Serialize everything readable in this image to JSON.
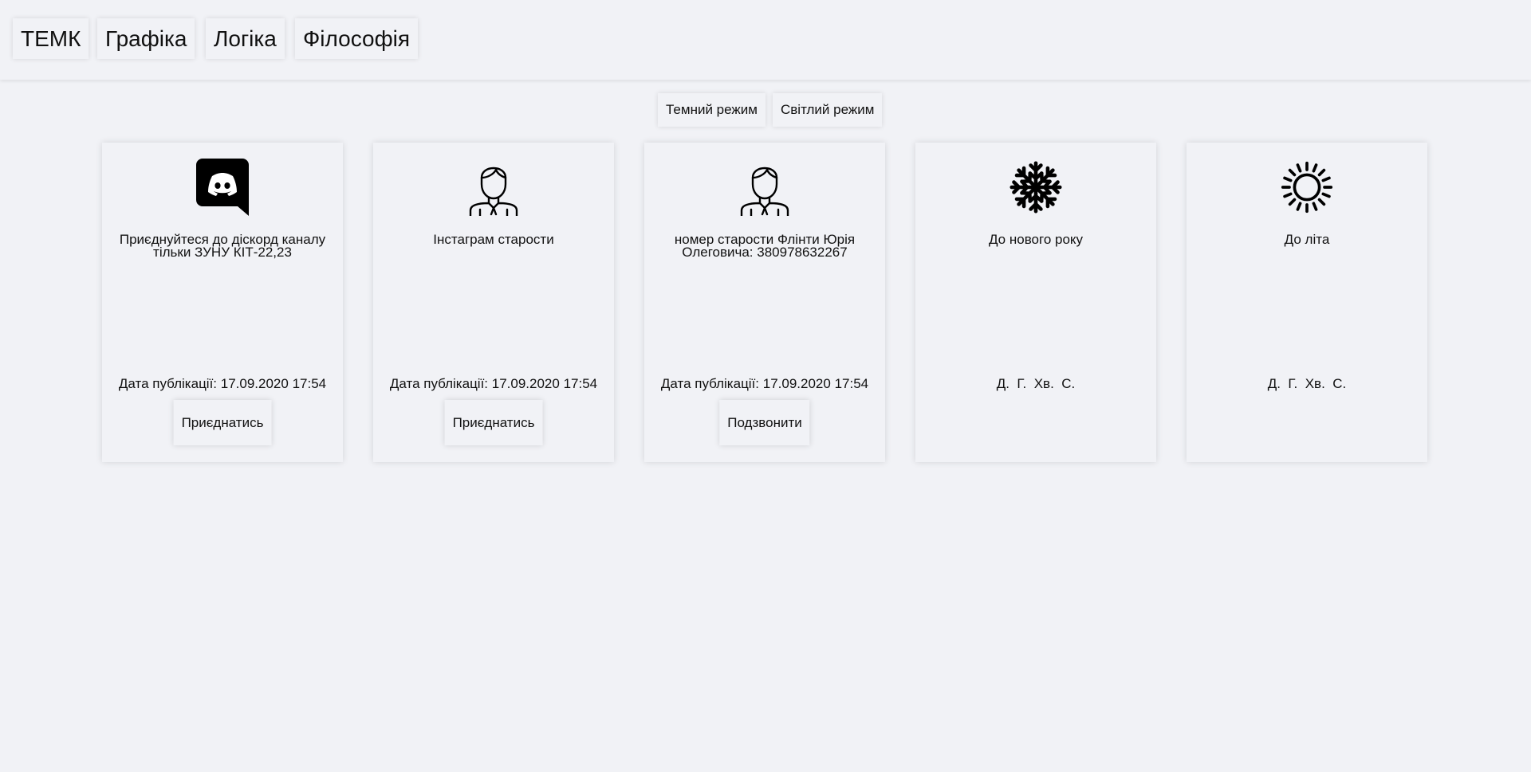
{
  "nav": {
    "items": [
      {
        "label": "ТЕМК"
      },
      {
        "label": "Графіка"
      },
      {
        "label": "Логіка"
      },
      {
        "label": "Філософія"
      }
    ]
  },
  "theme": {
    "dark_label": "Темний режим",
    "light_label": "Світлий режим"
  },
  "cards": [
    {
      "icon": "discord-icon",
      "title": "Приєднуйтеся до діскорд каналу тільки ЗУНУ КІТ-22,23",
      "date": "Дата публікації: 17.09.2020 17:54",
      "button": "Приєднатись"
    },
    {
      "icon": "person-icon",
      "title": "Інстаграм старости",
      "date": "Дата публікації: 17.09.2020 17:54",
      "button": "Приєднатись"
    },
    {
      "icon": "person-icon",
      "title": "номер старости Флінти Юрія Олеговича: 380978632267",
      "date": "Дата публікації: 17.09.2020 17:54",
      "button": "Подзвонити"
    },
    {
      "icon": "snowflake-icon",
      "title": "До нового року",
      "timer": "Д.  Г.  Хв.  С."
    },
    {
      "icon": "sun-icon",
      "title": "До літа",
      "timer": "Д.  Г.  Хв.  С."
    }
  ]
}
